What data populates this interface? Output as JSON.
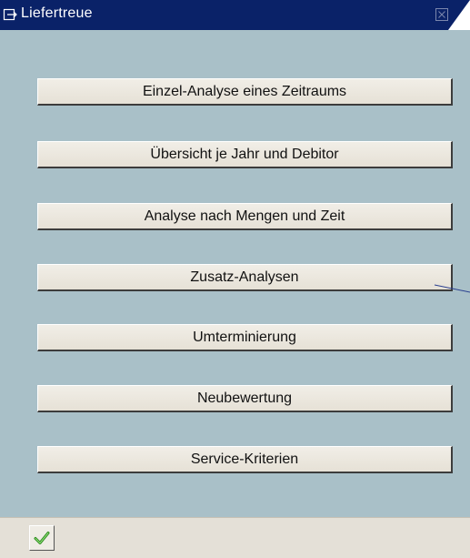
{
  "window": {
    "title": "Liefertreue"
  },
  "buttons": [
    {
      "label": "Einzel-Analyse eines Zeitraums"
    },
    {
      "label": "Übersicht je Jahr und Debitor"
    },
    {
      "label": "Analyse nach Mengen und Zeit"
    },
    {
      "label": "Zusatz-Analysen"
    },
    {
      "label": "Umterminierung"
    },
    {
      "label": "Neubewertung"
    },
    {
      "label": "Service-Kriterien"
    }
  ],
  "colors": {
    "title_bar": "#0a2268",
    "body": "#a9c0c8",
    "footer": "#e4e0d7",
    "button_face": "#ede9e1",
    "check": "#2e8b1e"
  },
  "icons": {
    "title": "dialog-window-icon",
    "close": "close-icon",
    "confirm": "checkmark-icon"
  }
}
